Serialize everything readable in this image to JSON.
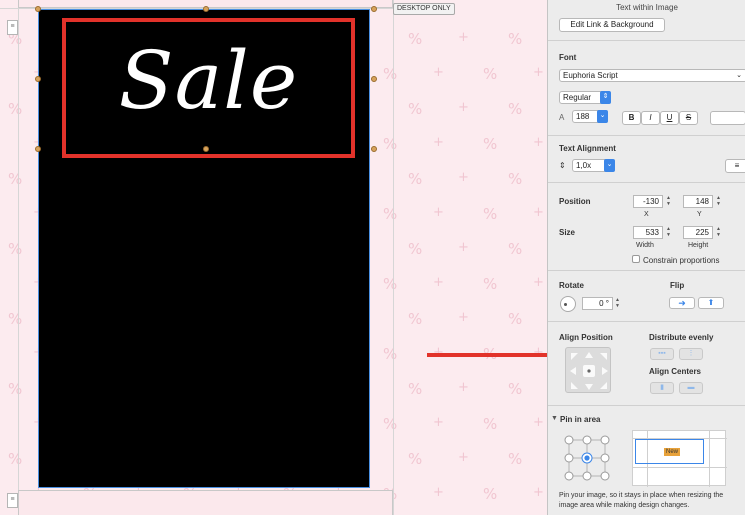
{
  "canvas": {
    "desktop_only_label": "DESKTOP ONLY",
    "headline_text": "Sale",
    "pattern_glyph_percent": "%",
    "pattern_glyph_plus": "+",
    "gutter_glyph": "≡"
  },
  "inspector": {
    "header": {
      "title": "Text within Image",
      "edit_link_button": "Edit Link & Background"
    },
    "font": {
      "title": "Font",
      "family": "Euphoria Script",
      "style": "Regular",
      "size": "188",
      "bold": "B",
      "italic": "I",
      "underline": "U",
      "strike": "S"
    },
    "alignment": {
      "title": "Text Alignment",
      "line_spacing": "1,0x"
    },
    "position": {
      "title": "Position",
      "x": "-130",
      "y": "148",
      "x_label": "X",
      "y_label": "Y"
    },
    "size": {
      "title": "Size",
      "width": "533",
      "height": "225",
      "width_label": "Width",
      "height_label": "Height",
      "constrain_label": "Constrain proportions"
    },
    "rotate": {
      "title": "Rotate",
      "value": "0 °"
    },
    "flip": {
      "title": "Flip"
    },
    "align": {
      "title": "Align Position",
      "distribute_title": "Distribute evenly",
      "centers_title": "Align Centers"
    },
    "pin": {
      "title": "Pin in area",
      "preview_badge": "New",
      "description": "Pin your image, so it stays in place when resizing the image area while making design changes."
    }
  },
  "colors": {
    "accent_blue": "#3b86e8",
    "highlight_red": "#e2322a",
    "handle_orange": "#d7a25b"
  }
}
